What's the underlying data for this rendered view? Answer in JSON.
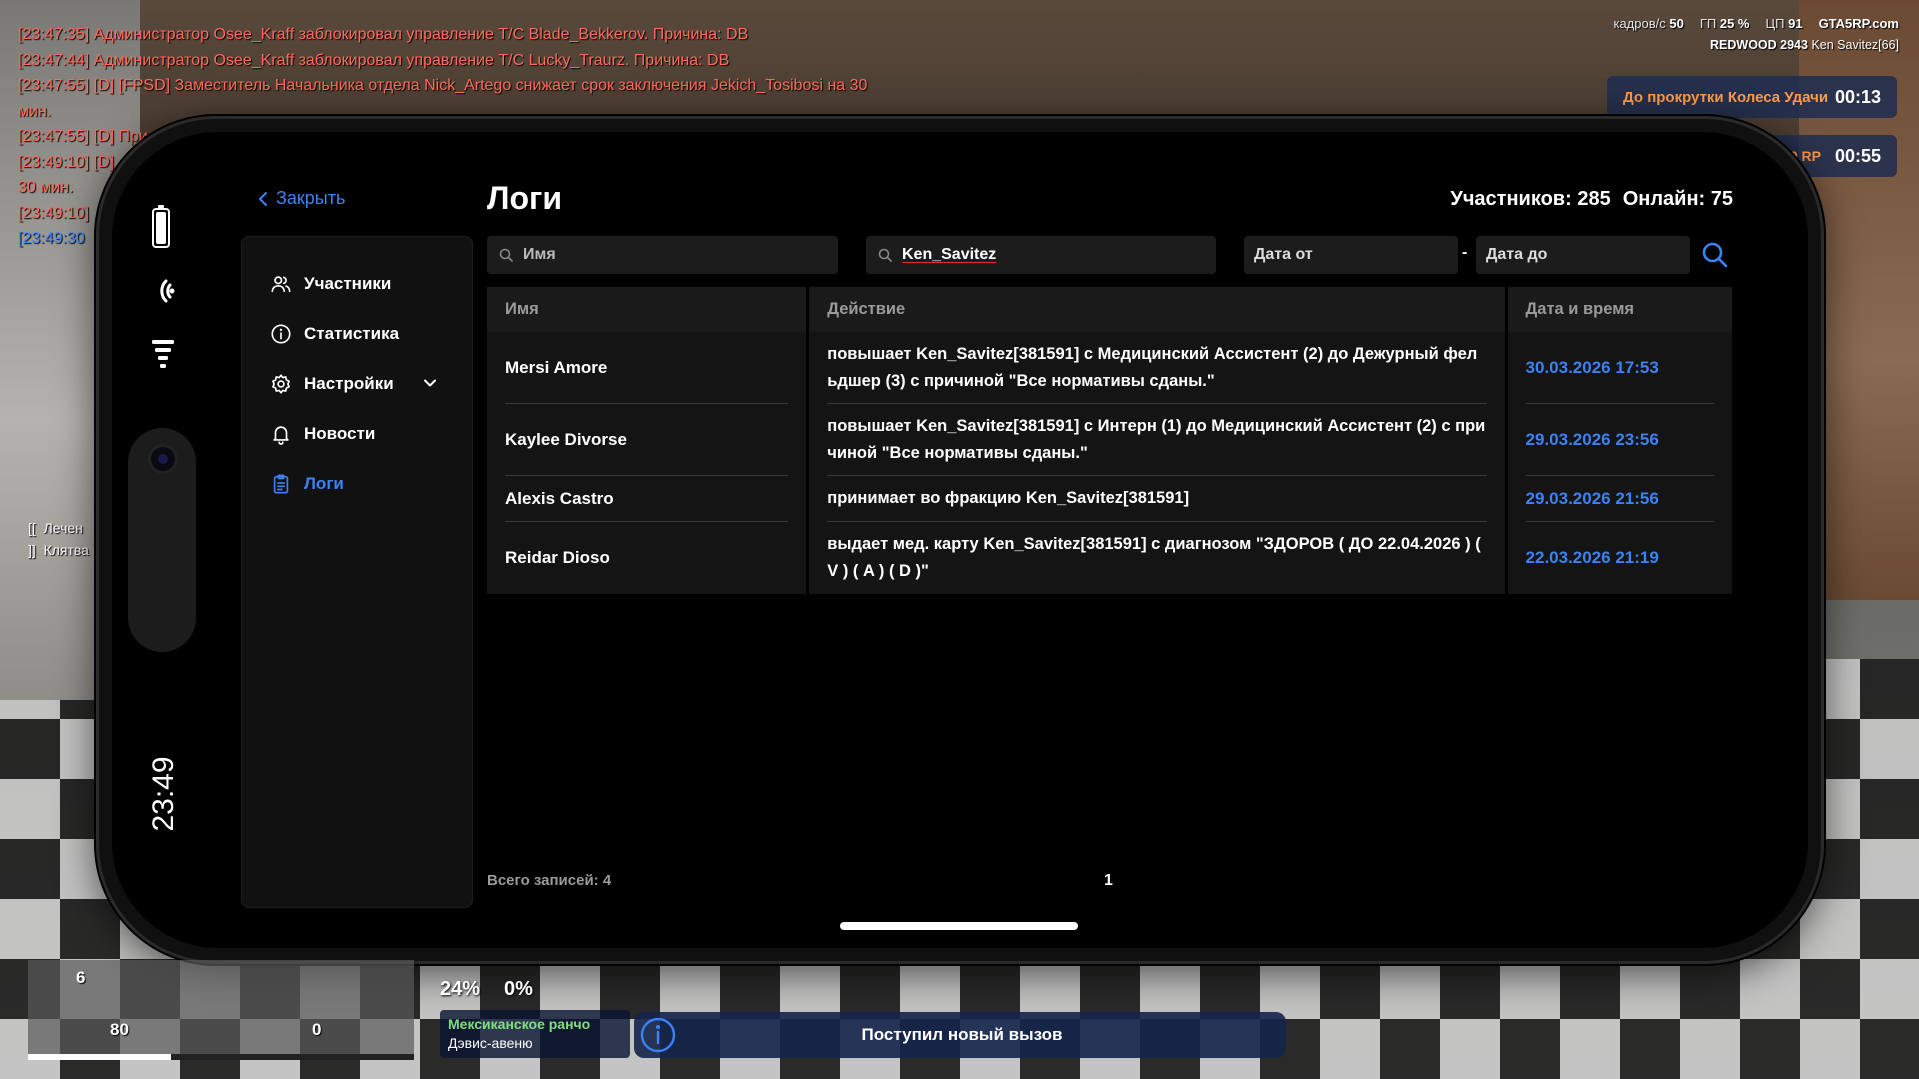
{
  "chat": [
    {
      "text": "[23:47:35] Администратор Osee_Kraff заблокировал управление Т/С Blade_Bekkerov. Причина: DB",
      "color": "red"
    },
    {
      "text": "[23:47:44] Администратор Osee_Kraff заблокировал управление Т/С Lucky_Traurz. Причина: DB",
      "color": "red"
    },
    {
      "text": "[23:47:55] [D] [FPSD] Заместитель Начальника отдела Nick_Artego снижает срок заключения Jekich_Tosibosi на 30",
      "color": "red"
    },
    {
      "text": "мин.",
      "color": "red"
    },
    {
      "text": "[23:47:55] [D] При",
      "color": "red"
    },
    {
      "text": "[23:49:10] [D]",
      "color": "red"
    },
    {
      "text": "30 мин.",
      "color": "red"
    },
    {
      "text": "[23:49:10]",
      "color": "red"
    },
    {
      "text": "[23:49:30",
      "color": "blue"
    }
  ],
  "hud": {
    "fps_label": "кадров/с",
    "fps_value": "50",
    "gpu_label": "ГП",
    "gpu_value": "25 %",
    "cpu_label": "ЦП",
    "cpu_value": "91",
    "brand": "GTA5RP.com",
    "server": "REDWOOD 2943",
    "player": "Ken Savitez[66]",
    "wheel_label": "До прокрутки Колеса Удачи",
    "wheel_timer": "00:13",
    "rp_label": "00 RP",
    "rp_timer": "00:55"
  },
  "left_tags": [
    "Лечен",
    "Клятва"
  ],
  "phone": {
    "clock": "23:49"
  },
  "app": {
    "close_label": "Закрыть",
    "title": "Логи",
    "members_count": "Участников: 285",
    "online_count": "Онлайн: 75",
    "nav": [
      {
        "label": "Участники",
        "icon": "users-icon",
        "active": false
      },
      {
        "label": "Статистика",
        "icon": "info-icon",
        "active": false
      },
      {
        "label": "Настройки",
        "icon": "gear-icon",
        "active": false,
        "expandable": true
      },
      {
        "label": "Новости",
        "icon": "bell-icon",
        "active": false
      },
      {
        "label": "Логи",
        "icon": "clipboard-icon",
        "active": true
      }
    ],
    "filters": {
      "name_placeholder": "Имя",
      "query_value": "Ken_Savitez",
      "date_from": "Дата от",
      "date_dash": "-",
      "date_to": "Дата до"
    },
    "table": {
      "headers": [
        "Имя",
        "Действие",
        "Дата и время"
      ],
      "rows": [
        {
          "name": "Mersi Amore",
          "action": "повышает Ken_Savitez[381591] с Медицинский Ассистент (2) до Дежурный фельдшер (3) с причиной \"Все нормативы сданы.\"",
          "datetime": "30.03.2026 17:53"
        },
        {
          "name": "Kaylee Divorse",
          "action": "повышает Ken_Savitez[381591] с Интерн (1) до Медицинский Ассистент (2) с причиной \"Все нормативы сданы.\"",
          "datetime": "29.03.2026 23:56"
        },
        {
          "name": "Alexis Castro",
          "action": "принимает во фракцию Ken_Savitez[381591]",
          "datetime": "29.03.2026 21:56"
        },
        {
          "name": "Reidar Dioso",
          "action": "выдает мед. карту Ken_Savitez[381591] с диагнозом \"ЗДОРОВ ( ДО 22.04.2026 ) ( V ) ( A ) ( D )\"",
          "datetime": "22.03.2026 21:19"
        }
      ]
    },
    "total_label": "Всего записей: 4",
    "page": "1"
  },
  "bottom_hud": {
    "minimap_left": "80",
    "minimap_right": "0",
    "minimap_mid": "6",
    "hunger": "24%",
    "thirst": "0%",
    "zone": "Мексиканское ранчо",
    "street": "Дэвис-авеню",
    "notification": "Поступил новый вызов"
  },
  "colors": {
    "accent": "#3b82f6",
    "chat_red": "#ff6a5a",
    "chat_blue": "#4d8cff",
    "orange": "#ff9a4a",
    "zone_green": "#7ee07e"
  }
}
